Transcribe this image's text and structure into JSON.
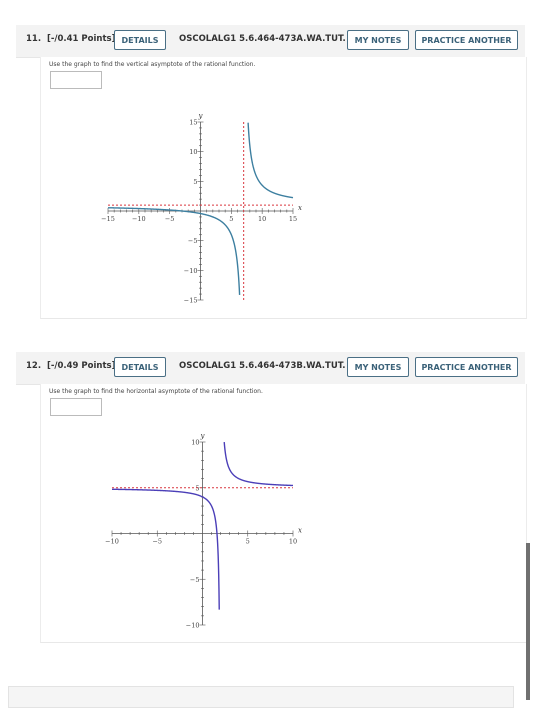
{
  "questions": [
    {
      "number": "11.",
      "points": "[-/0.41 Points]",
      "details_label": "DETAILS",
      "code": "OSCOLALG1 5.6.464-473A.WA.TUT.",
      "my_notes_label": "MY NOTES",
      "practice_label": "PRACTICE ANOTHER",
      "prompt": "Use the graph to find the vertical asymptote of the rational function.",
      "answer_value": "",
      "graph": {
        "type": "line",
        "xlabel": "x",
        "ylabel": "y",
        "xlim": [
          -15,
          15
        ],
        "ylim": [
          -15,
          15
        ],
        "x_ticks": [
          "-15",
          "-10",
          "-5",
          "5",
          "10",
          "15"
        ],
        "y_ticks": [
          "15",
          "10",
          "5",
          "-5",
          "-10",
          "-15"
        ],
        "function": "y = 1 + 10/(x - 7)",
        "vertical_asymptote": 7,
        "horizontal_asymptote": 1,
        "curve_color": "#3d7fa0",
        "asymptote_color": "#d9363e"
      }
    },
    {
      "number": "12.",
      "points": "[-/0.49 Points]",
      "details_label": "DETAILS",
      "code": "OSCOLALG1 5.6.464-473B.WA.TUT.",
      "my_notes_label": "MY NOTES",
      "practice_label": "PRACTICE ANOTHER",
      "prompt": "Use the graph to find the horizontal asymptote of the rational function.",
      "answer_value": "",
      "graph": {
        "type": "line",
        "xlabel": "x",
        "ylabel": "y",
        "xlim": [
          -10,
          10
        ],
        "ylim": [
          -10,
          10
        ],
        "x_ticks": [
          "-10",
          "-5",
          "5",
          "10"
        ],
        "y_ticks": [
          "10",
          "5",
          "-5",
          "-10"
        ],
        "function": "y = 5 + 2/(x - 2)",
        "vertical_asymptote": 2,
        "horizontal_asymptote": 5,
        "curve_color": "#4b3fb8",
        "asymptote_color": "#d9363e"
      }
    }
  ],
  "chart_data": [
    {
      "type": "line",
      "title": "",
      "xlabel": "x",
      "ylabel": "y",
      "xlim": [
        -15,
        15
      ],
      "ylim": [
        -15,
        15
      ],
      "x_ticks": [
        -15,
        -10,
        -5,
        5,
        10,
        15
      ],
      "y_ticks": [
        15,
        10,
        5,
        -5,
        -10,
        -15
      ],
      "series": [
        {
          "name": "f(x) = 1 + 10/(x-7)",
          "vertical_asymptote": 7,
          "horizontal_asymptote": 1
        }
      ],
      "grid": false
    },
    {
      "type": "line",
      "title": "",
      "xlabel": "x",
      "ylabel": "y",
      "xlim": [
        -10,
        10
      ],
      "ylim": [
        -10,
        10
      ],
      "x_ticks": [
        -10,
        -5,
        5,
        10
      ],
      "y_ticks": [
        10,
        5,
        -5,
        -10
      ],
      "series": [
        {
          "name": "f(x) = 5 + 2/(x-2)",
          "vertical_asymptote": 2,
          "horizontal_asymptote": 5
        }
      ],
      "grid": false
    }
  ]
}
